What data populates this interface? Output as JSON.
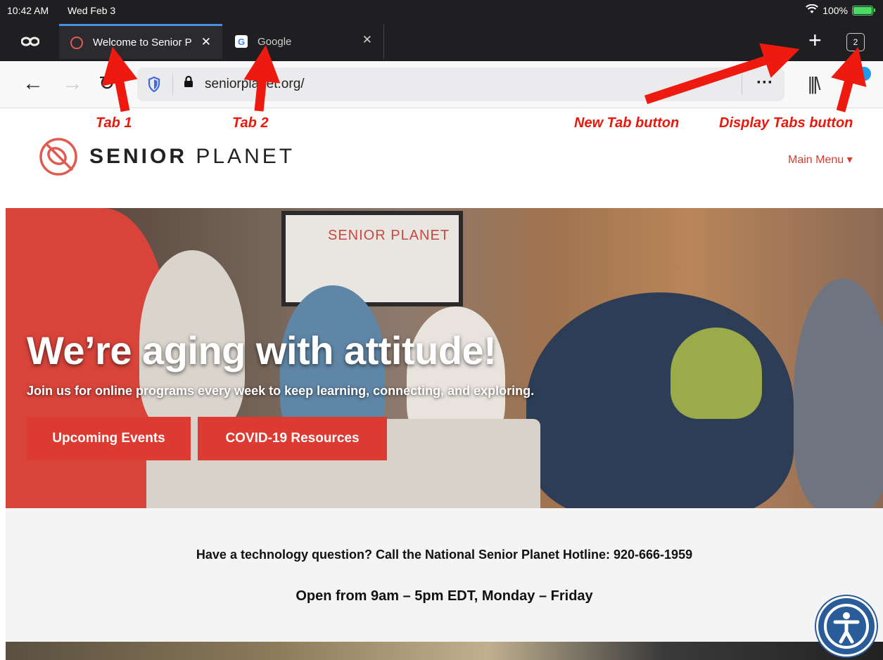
{
  "status_bar": {
    "time": "10:42 AM",
    "date": "Wed Feb 3",
    "battery": "100%"
  },
  "tabs": [
    {
      "title": "Welcome to Senior P",
      "active": true
    },
    {
      "title": "Google",
      "active": false
    }
  ],
  "tab_count": "2",
  "address_bar": {
    "url": "seniorplanet.org/"
  },
  "annotations": {
    "tab1": "Tab 1",
    "tab2": "Tab 2",
    "new_tab": "New Tab button",
    "display_tabs": "Display Tabs button"
  },
  "site": {
    "logo_bold": "SENIOR",
    "logo_light": " PLANET",
    "main_menu": "Main Menu ▾",
    "hero_screen_text": "SENIOR PLANET",
    "hero_title": "We’re aging with attitude!",
    "hero_subtitle": "Join us for online programs every week to keep learning, connecting, and exploring.",
    "buttons": {
      "events": "Upcoming Events",
      "covid": "COVID-19 Resources"
    },
    "hotline": "Have a technology question? Call the National Senior Planet Hotline: 920-666-1959",
    "hours": "Open from 9am – 5pm EDT, Monday – Friday"
  },
  "colors": {
    "accent": "#dd3a32",
    "annotation": "#e8180c",
    "tab_highlight": "#4a90e2"
  }
}
